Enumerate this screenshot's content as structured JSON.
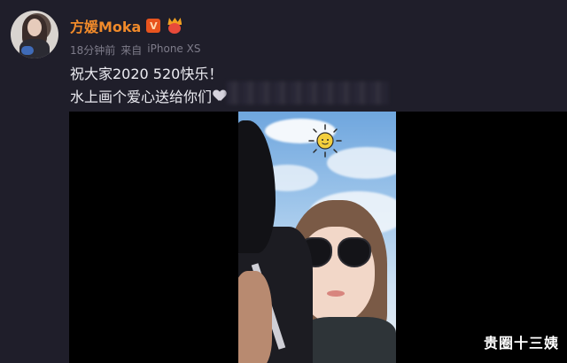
{
  "post": {
    "author": "方媛Moka",
    "verified_badge": "V",
    "member_badge": "crown-member-icon",
    "time": "18分钟前",
    "source_prefix": "来自",
    "source": "iPhone XS",
    "line1": "祝大家2020 520快乐！",
    "line2": "水上画个爱心送给你们"
  },
  "media": {
    "watermark": "贵圈十三姨"
  },
  "colors": {
    "background": "#1f1e2a",
    "author": "#f08a2a",
    "meta": "#7e7c8a",
    "text": "#ececf2",
    "verified_badge": "#e8541e"
  }
}
